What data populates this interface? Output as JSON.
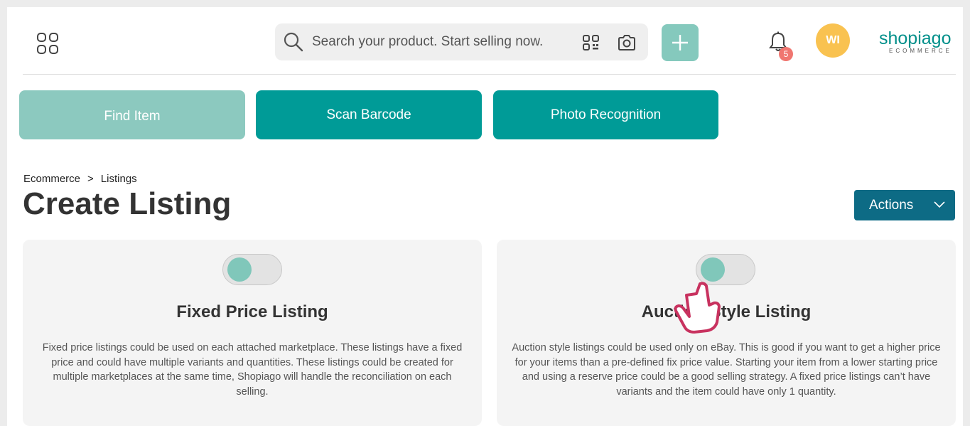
{
  "header": {
    "search": {
      "placeholder": "Search your product. Start selling now."
    },
    "notifications": {
      "count": "5"
    },
    "avatar": {
      "initials": "WI",
      "color": "#f9c250"
    },
    "logo": {
      "word": "shopiago",
      "sub": "ECOMMERCE"
    }
  },
  "modes": [
    {
      "label": "Find Item",
      "state": "selected",
      "color": "#8cc9bf"
    },
    {
      "label": "Scan Barcode",
      "color": "#009b97"
    },
    {
      "label": "Photo Recognition",
      "color": "#009b97"
    }
  ],
  "breadcrumb": {
    "items": [
      "Ecommerce",
      "Listings"
    ],
    "separator": ">"
  },
  "page": {
    "title": "Create Listing"
  },
  "actions": {
    "label": "Actions"
  },
  "cards": [
    {
      "title": "Fixed Price Listing",
      "description": "Fixed price listings could be used on each attached marketplace. These listings have a fixed price and could have multiple variants and quantities. These listings could be created for multiple marketplaces at the same time, Shopiago will handle the reconciliation on each selling.",
      "toggle": "off"
    },
    {
      "title": "Auction Style Listing",
      "description": "Auction style listings could be used only on eBay. This is good if you want to get a higher price for your items than a pre-defined fix price value. Starting your item from a lower starting price and using a reserve price could be a good selling strategy. A fixed price listings can’t have variants and the item could have only 1 quantity.",
      "toggle": "off"
    }
  ],
  "icons": {
    "apps": "grid-icon",
    "search": "search-icon",
    "qr": "qr-code-icon",
    "camera": "camera-icon",
    "add": "plus-icon",
    "bell": "bell-icon",
    "chevron": "chevron-down-icon",
    "pointer": "hand-pointer-cursor-icon"
  },
  "colors": {
    "teal": "#009b97",
    "teal_light": "#8cc9bf",
    "actions": "#0d6b85",
    "badge": "#f07670",
    "pointer": "#c8325f"
  }
}
